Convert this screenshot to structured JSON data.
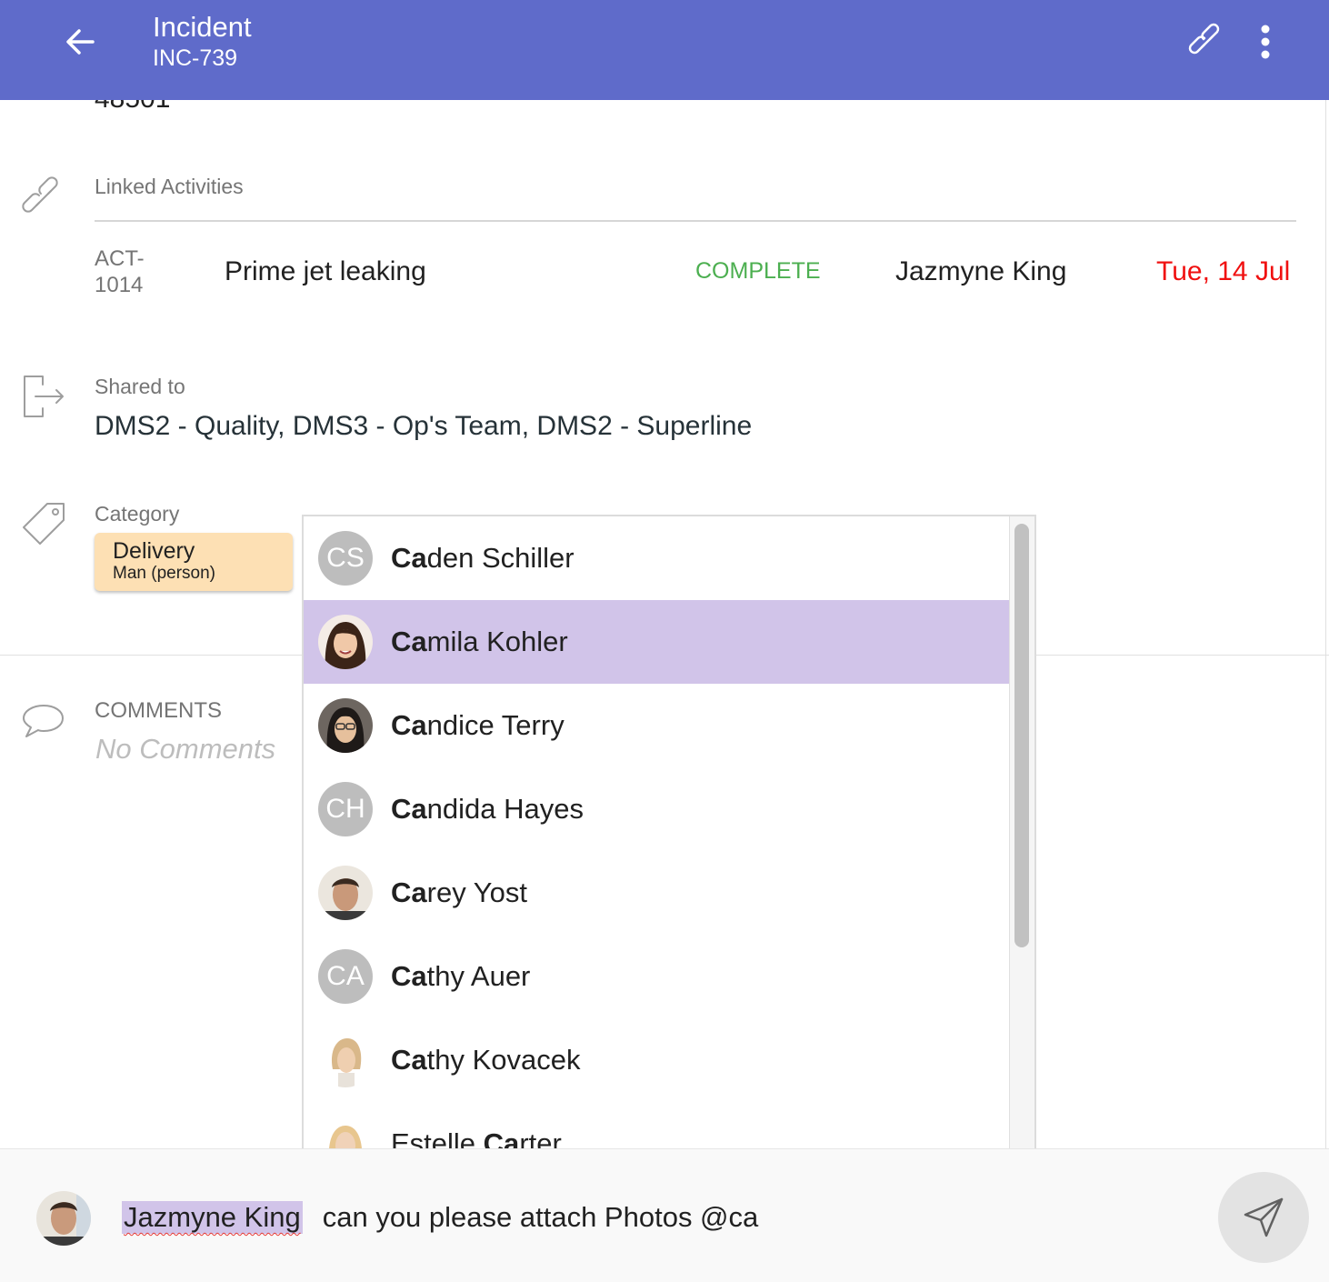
{
  "header": {
    "title": "Incident",
    "subtitle": "INC-739",
    "back_icon": "arrow-left-icon",
    "link_icon": "link-icon",
    "more_icon": "more-vertical-icon",
    "background": "#5f6bca"
  },
  "cut_off_text": "48501",
  "linked_activities": {
    "label": "Linked Activities",
    "icon": "link-icon",
    "items": [
      {
        "id": "ACT-1014",
        "title": "Prime jet leaking",
        "status": "COMPLETE",
        "status_color": "#4caf50",
        "assignee": "Jazmyne King",
        "due": "Tue, 14 Jul",
        "due_color": "#f01010"
      }
    ]
  },
  "shared": {
    "label": "Shared to",
    "icon": "share-exit-icon",
    "value": "DMS2 - Quality, DMS3 - Op's Team, DMS2 - Superline"
  },
  "category": {
    "label": "Category",
    "icon": "tag-icon",
    "chip": {
      "title": "Delivery",
      "subtitle": "Man (person)",
      "color": "#fde0b4"
    }
  },
  "comments": {
    "label": "COMMENTS",
    "icon": "comment-bubble-icon",
    "empty_text": "No Comments"
  },
  "mention_dropdown": {
    "query": "Ca",
    "selected_index": 1,
    "items": [
      {
        "match": "Ca",
        "rest": "den Schiller",
        "initials": "CS",
        "avatar": "initials"
      },
      {
        "match": "Ca",
        "rest": "mila Kohler",
        "initials": "",
        "avatar": "photo"
      },
      {
        "match": "Ca",
        "rest": "ndice Terry",
        "initials": "",
        "avatar": "photo"
      },
      {
        "match": "Ca",
        "rest": "ndida Hayes",
        "initials": "CH",
        "avatar": "initials"
      },
      {
        "match": "Ca",
        "rest": "rey Yost",
        "initials": "",
        "avatar": "photo"
      },
      {
        "match": "Ca",
        "rest": "thy Auer",
        "initials": "CA",
        "avatar": "initials"
      },
      {
        "match": "Ca",
        "rest": "thy Kovacek",
        "initials": "",
        "avatar": "photo"
      },
      {
        "prefix": "Estelle ",
        "match": "Ca",
        "rest": "rter",
        "initials": "",
        "avatar": "photo"
      }
    ]
  },
  "composer": {
    "mention": "Jazmyne King",
    "text": "can you please attach Photos @ca",
    "send_icon": "send-icon"
  }
}
